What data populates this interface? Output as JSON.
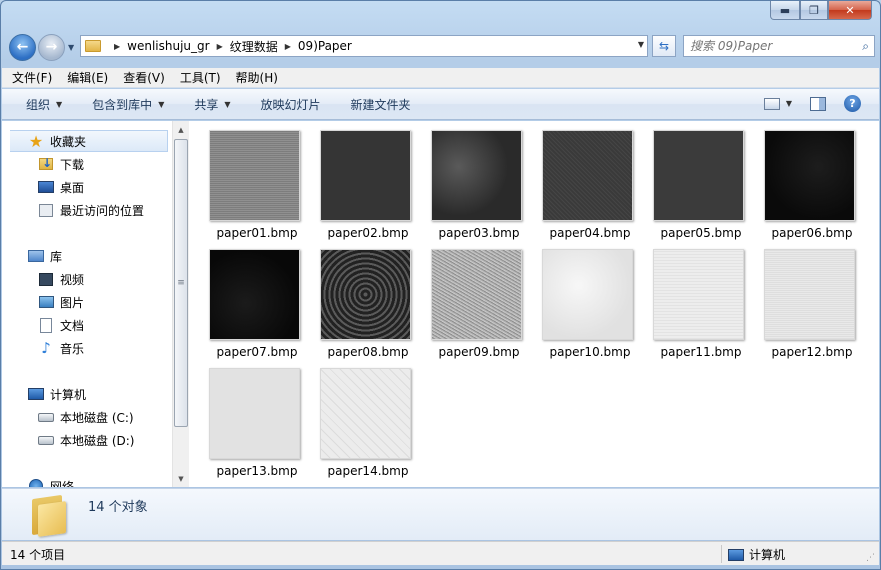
{
  "window": {
    "caption_min": "▬",
    "caption_max": "❐",
    "caption_close": "✕"
  },
  "nav": {
    "back_glyph": "←",
    "forward_glyph": "→",
    "history_glyph": "▼",
    "breadcrumbs": [
      "wenlishuju_gr",
      "纹理数据",
      "09)Paper"
    ],
    "crumb_sep": "▶",
    "addr_drop": "▼",
    "refresh_glyph": "⇆",
    "search_placeholder": "搜索 09)Paper",
    "search_glyph": "⌕"
  },
  "menu": [
    "文件(F)",
    "编辑(E)",
    "查看(V)",
    "工具(T)",
    "帮助(H)"
  ],
  "commands": {
    "organize": "组织",
    "include_library": "包含到库中",
    "share": "共享",
    "slideshow": "放映幻灯片",
    "new_folder": "新建文件夹",
    "dropdown_glyph": "▼",
    "help_glyph": "?"
  },
  "sidebar": {
    "favorites": "收藏夹",
    "downloads": "下载",
    "desktop": "桌面",
    "recent": "最近访问的位置",
    "libraries": "库",
    "videos": "视频",
    "pictures": "图片",
    "documents": "文档",
    "music": "音乐",
    "computer": "计算机",
    "drive_c": "本地磁盘 (C:)",
    "drive_d": "本地磁盘 (D:)",
    "network": "网络",
    "star_glyph": "★",
    "music_glyph": "♪"
  },
  "scrollbar": {
    "up": "▲",
    "down": "▼",
    "grip": "≡"
  },
  "files": [
    "paper01.bmp",
    "paper02.bmp",
    "paper03.bmp",
    "paper04.bmp",
    "paper05.bmp",
    "paper06.bmp",
    "paper07.bmp",
    "paper08.bmp",
    "paper09.bmp",
    "paper10.bmp",
    "paper11.bmp",
    "paper12.bmp",
    "paper13.bmp",
    "paper14.bmp"
  ],
  "details": {
    "count_text": "14 个对象"
  },
  "status": {
    "items_text": "14 个项目",
    "location": "计算机",
    "grip": "⋰"
  }
}
